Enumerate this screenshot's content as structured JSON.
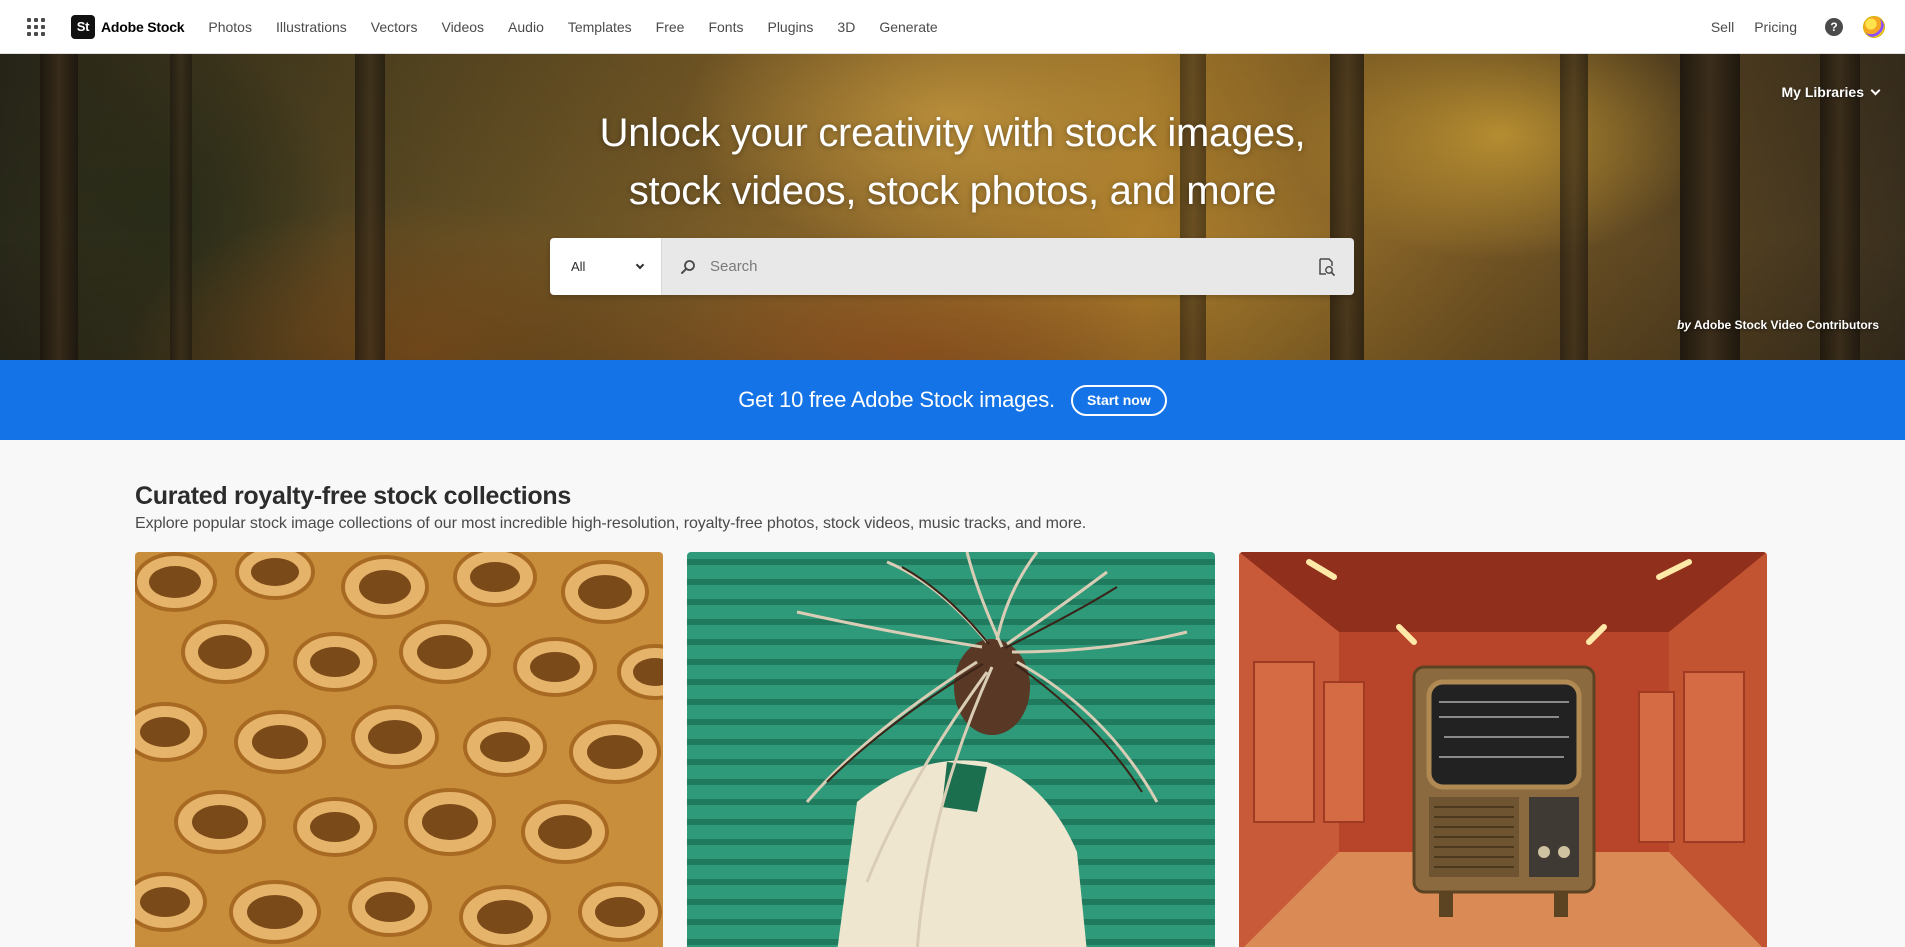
{
  "nav": {
    "brand": "Adobe Stock",
    "brand_mark": "St",
    "links": [
      "Photos",
      "Illustrations",
      "Vectors",
      "Videos",
      "Audio",
      "Templates",
      "Free",
      "Fonts",
      "Plugins",
      "3D",
      "Generate"
    ],
    "right_links": [
      "Sell",
      "Pricing"
    ],
    "help_glyph": "?"
  },
  "hero": {
    "title_line1": "Unlock your creativity with stock images,",
    "title_line2": "stock videos, stock photos, and more",
    "my_libraries": "My Libraries",
    "attribution_by": "by",
    "attribution_name": "Adobe Stock Video Contributors"
  },
  "search": {
    "scope_value": "All",
    "placeholder": "Search"
  },
  "promo": {
    "text": "Get 10 free Adobe Stock images.",
    "button": "Start now",
    "color": "#1473e6"
  },
  "collections": {
    "title": "Curated royalty-free stock collections",
    "subtitle": "Explore popular stock image collections of our most incredible high-resolution, royalty-free photos, stock videos, music tracks, and more."
  },
  "icons": {
    "apps": "apps-grid-icon",
    "search": "search-icon",
    "visual_search": "visual-search-icon",
    "help": "help-icon",
    "chevron": "chevron-down-icon"
  }
}
